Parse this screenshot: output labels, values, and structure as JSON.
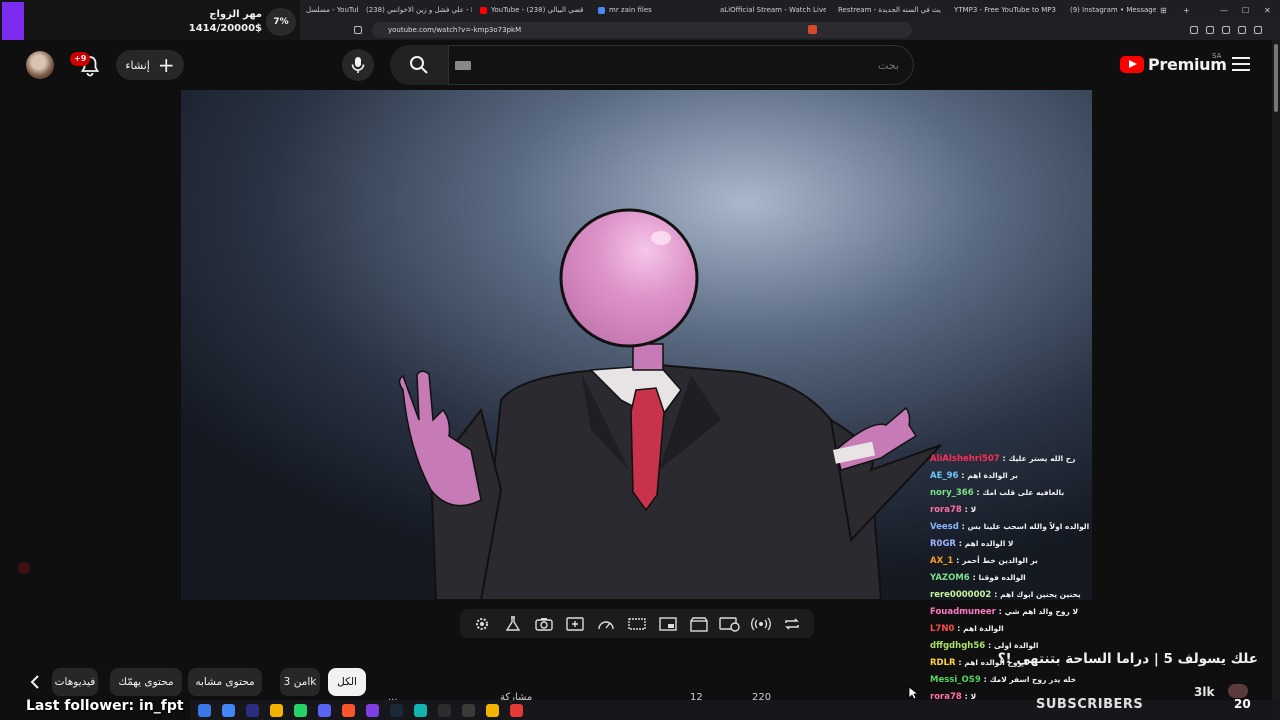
{
  "browser": {
    "tabs": [
      {
        "label": "مسلسل - YouTube",
        "color": "#ff0000"
      },
      {
        "label": "(238) علي فشل و زين الاخوانس - II",
        "color": "#ff0000"
      },
      {
        "label": "YouTube - قصي البيالي (238)",
        "color": "#ff0000"
      },
      {
        "label": "mr zain files",
        "color": "#4a8af4"
      },
      {
        "label": "aLiOfficial Stream - Watch Live",
        "color": "#53fc18"
      },
      {
        "label": "Restream - أول يث في السنه الجديدة",
        "color": "#3b82f6"
      },
      {
        "label": "YTMP3 - Free YouTube to MP3 Co",
        "color": "#1e90ff"
      },
      {
        "label": "(9) Instagram • Messages",
        "color": "#e1306c"
      }
    ],
    "new_tab": "+",
    "url": "youtube.com/watch?v=-kmp3o73pkM"
  },
  "mahr_widget": {
    "title": "مهر الزواج",
    "amount": "1414/20000$",
    "percent": "7%",
    "progress": 0.07,
    "accent": "#7c2cf0"
  },
  "masthead": {
    "notification_badge": "+9",
    "create_label": "إنشاء",
    "search_placeholder": "بحث",
    "logo_text": "Premium",
    "region": "SA"
  },
  "player_controls": [
    "settings-icon",
    "flask-icon",
    "camera-icon",
    "add-box-icon",
    "speedometer-icon",
    "subtitles-icon",
    "picture-in-picture-icon",
    "clapperboard-icon",
    "cast-icon",
    "live-broadcast-icon",
    "loop-icon"
  ],
  "chat": {
    "messages": [
      {
        "user": "AliAlshehri507",
        "text": "رح الله يستر عليك",
        "color": "#ff2d55"
      },
      {
        "user": "AE_96",
        "text": "بر الوالدة اهم",
        "color": "#6ec6ff"
      },
      {
        "user": "nory_366",
        "text": "بالعافيه على قلب امك",
        "color": "#7be08a"
      },
      {
        "user": "rora78",
        "text": "لا",
        "color": "#ff6fa8"
      },
      {
        "user": "Veesd",
        "text": "الوالده اولاً والله اسحب علينا بس",
        "color": "#8ab4ff"
      },
      {
        "user": "R0GR",
        "text": "لا الوالده اهم",
        "color": "#9db7ff"
      },
      {
        "user": "AX_1",
        "text": "بر الوالدين خط أحمر",
        "color": "#ff9f1a"
      },
      {
        "user": "YAZOM6",
        "text": "الوالده فوقنا",
        "color": "#7be08a"
      },
      {
        "user": "rere0000002",
        "text": "يحنين يحنين ابوك اهم",
        "color": "#c9f5a0"
      },
      {
        "user": "Fouadmuneer",
        "text": "لا روح والد اهم شي",
        "color": "#ff7ac6"
      },
      {
        "user": "L7N0",
        "text": "الوالدة اهم",
        "color": "#ff4d4d"
      },
      {
        "user": "dffgdhgh56",
        "text": "الوالدة اولى",
        "color": "#a8e06a"
      },
      {
        "user": "RDLR",
        "text": "لا روح الوالده اهم",
        "color": "#ffd23f"
      },
      {
        "user": "Messi_OS9",
        "text": "خله يدر روح اسفر لامك",
        "color": "#56d364"
      },
      {
        "user": "rora78",
        "text": "لا",
        "color": "#ff6fa8"
      }
    ]
  },
  "video": {
    "title": "علك يسولف 5 | دراما الساحة بتنتهي !؟"
  },
  "chips": [
    {
      "label": "الكل",
      "active": true
    },
    {
      "label": "من 3lk",
      "active": false
    },
    {
      "label": "محتوى مشابه",
      "active": false
    },
    {
      "label": "محتوى يهمّك",
      "active": false
    },
    {
      "label": "فيديوهات",
      "active": false
    }
  ],
  "actions": [
    "...",
    "مشاركة",
    "12",
    "220"
  ],
  "overlay": {
    "last_follower": "Last follower: in_fpt",
    "channel_short": "3lk",
    "subscribers_label": "SUBSCRIBERS",
    "subscribers_count": "20"
  }
}
